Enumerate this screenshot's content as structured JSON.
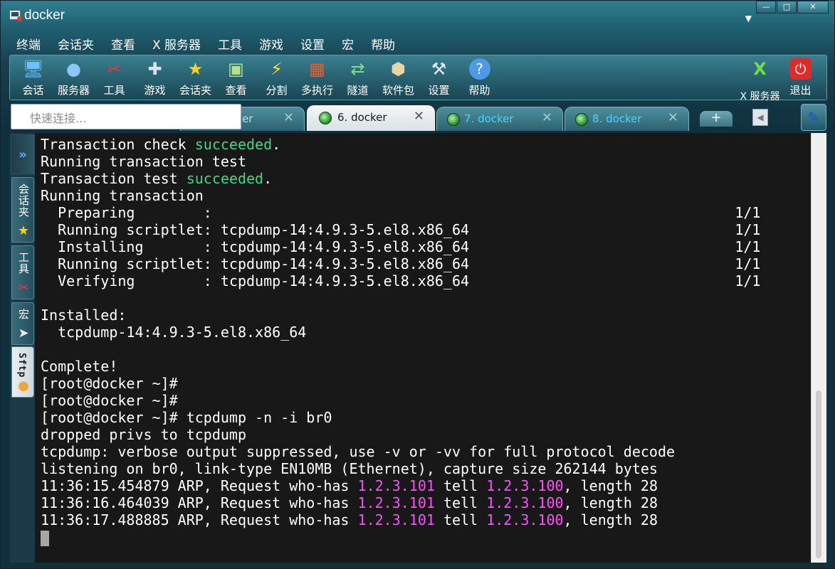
{
  "window": {
    "title": "docker"
  },
  "menu": [
    "终端",
    "会话夹",
    "查看",
    "X 服务器",
    "工具",
    "游戏",
    "设置",
    "宏",
    "帮助"
  ],
  "toolbar": {
    "left": [
      {
        "label": "会话",
        "icon": "session-icon"
      },
      {
        "label": "服务器",
        "icon": "server-icon"
      },
      {
        "label": "工具",
        "icon": "tools-icon"
      },
      {
        "label": "游戏",
        "icon": "gamepad-icon"
      },
      {
        "label": "会话夹",
        "icon": "star-icon"
      },
      {
        "label": "查看",
        "icon": "monitor-icon"
      },
      {
        "label": "分割",
        "icon": "split-icon"
      },
      {
        "label": "多执行",
        "icon": "windows-icon"
      },
      {
        "label": "隧道",
        "icon": "tunnel-icon"
      },
      {
        "label": "软件包",
        "icon": "package-icon"
      },
      {
        "label": "设置",
        "icon": "settings-icon"
      },
      {
        "label": "帮助",
        "icon": "help-icon"
      }
    ],
    "right": [
      {
        "label": "X 服务器",
        "icon": "x-server-icon"
      },
      {
        "label": "退出",
        "icon": "power-icon"
      }
    ]
  },
  "quick_connect": {
    "placeholder": "快速连接..."
  },
  "tabs": [
    {
      "label": "er",
      "active": false
    },
    {
      "label": "6. docker",
      "active": true
    },
    {
      "label": "7. docker",
      "active": false
    },
    {
      "label": "8. docker",
      "active": false
    }
  ],
  "sidebar": {
    "tabs": [
      {
        "label": "会话夹",
        "icon": "star-icon"
      },
      {
        "label": "工具",
        "icon": "tools-icon"
      },
      {
        "label": "宏",
        "icon": "macro-arrow-icon"
      },
      {
        "label": "Sftp",
        "icon": "sftp-icon"
      }
    ]
  },
  "terminal": {
    "lines": [
      [
        {
          "t": "Transaction check "
        },
        {
          "t": "succeeded",
          "c": "g"
        },
        {
          "t": "."
        }
      ],
      [
        {
          "t": "Running transaction test"
        }
      ],
      [
        {
          "t": "Transaction test "
        },
        {
          "t": "succeeded",
          "c": "g"
        },
        {
          "t": "."
        }
      ],
      [
        {
          "t": "Running transaction"
        }
      ],
      [
        {
          "t": "  Preparing        :                                                             1/1"
        }
      ],
      [
        {
          "t": "  Running scriptlet: tcpdump-14:4.9.3-5.el8.x86_64                               1/1"
        }
      ],
      [
        {
          "t": "  Installing       : tcpdump-14:4.9.3-5.el8.x86_64                               1/1"
        }
      ],
      [
        {
          "t": "  Running scriptlet: tcpdump-14:4.9.3-5.el8.x86_64                               1/1"
        }
      ],
      [
        {
          "t": "  Verifying        : tcpdump-14:4.9.3-5.el8.x86_64                               1/1"
        }
      ],
      [
        {
          "t": ""
        }
      ],
      [
        {
          "t": "Installed:"
        }
      ],
      [
        {
          "t": "  tcpdump-14:4.9.3-5.el8.x86_64"
        }
      ],
      [
        {
          "t": ""
        }
      ],
      [
        {
          "t": "Complete!"
        }
      ],
      [
        {
          "t": "[root@docker ~]#"
        }
      ],
      [
        {
          "t": "[root@docker ~]#"
        }
      ],
      [
        {
          "t": "[root@docker ~]# tcpdump -n -i br0"
        }
      ],
      [
        {
          "t": "dropped privs to tcpdump"
        }
      ],
      [
        {
          "t": "tcpdump: verbose output suppressed, use -v or -vv for full protocol decode"
        }
      ],
      [
        {
          "t": "listening on br0, link-type EN10MB (Ethernet), capture size 262144 bytes"
        }
      ],
      [
        {
          "t": "11:36:15.454879 ARP, Request who-has "
        },
        {
          "t": "1.2.3.101",
          "c": "m"
        },
        {
          "t": " tell "
        },
        {
          "t": "1.2.3.100",
          "c": "m"
        },
        {
          "t": ", length 28"
        }
      ],
      [
        {
          "t": "11:36:16.464039 ARP, Request who-has "
        },
        {
          "t": "1.2.3.101",
          "c": "m"
        },
        {
          "t": " tell "
        },
        {
          "t": "1.2.3.100",
          "c": "m"
        },
        {
          "t": ", length 28"
        }
      ],
      [
        {
          "t": "11:36:17.488885 ARP, Request who-has "
        },
        {
          "t": "1.2.3.101",
          "c": "m"
        },
        {
          "t": " tell "
        },
        {
          "t": "1.2.3.100",
          "c": "m"
        },
        {
          "t": ", length 28"
        }
      ]
    ]
  },
  "colors": {
    "success": "#3fd98b",
    "ip": "#ff4dff",
    "terminal_bg": "#181818"
  }
}
